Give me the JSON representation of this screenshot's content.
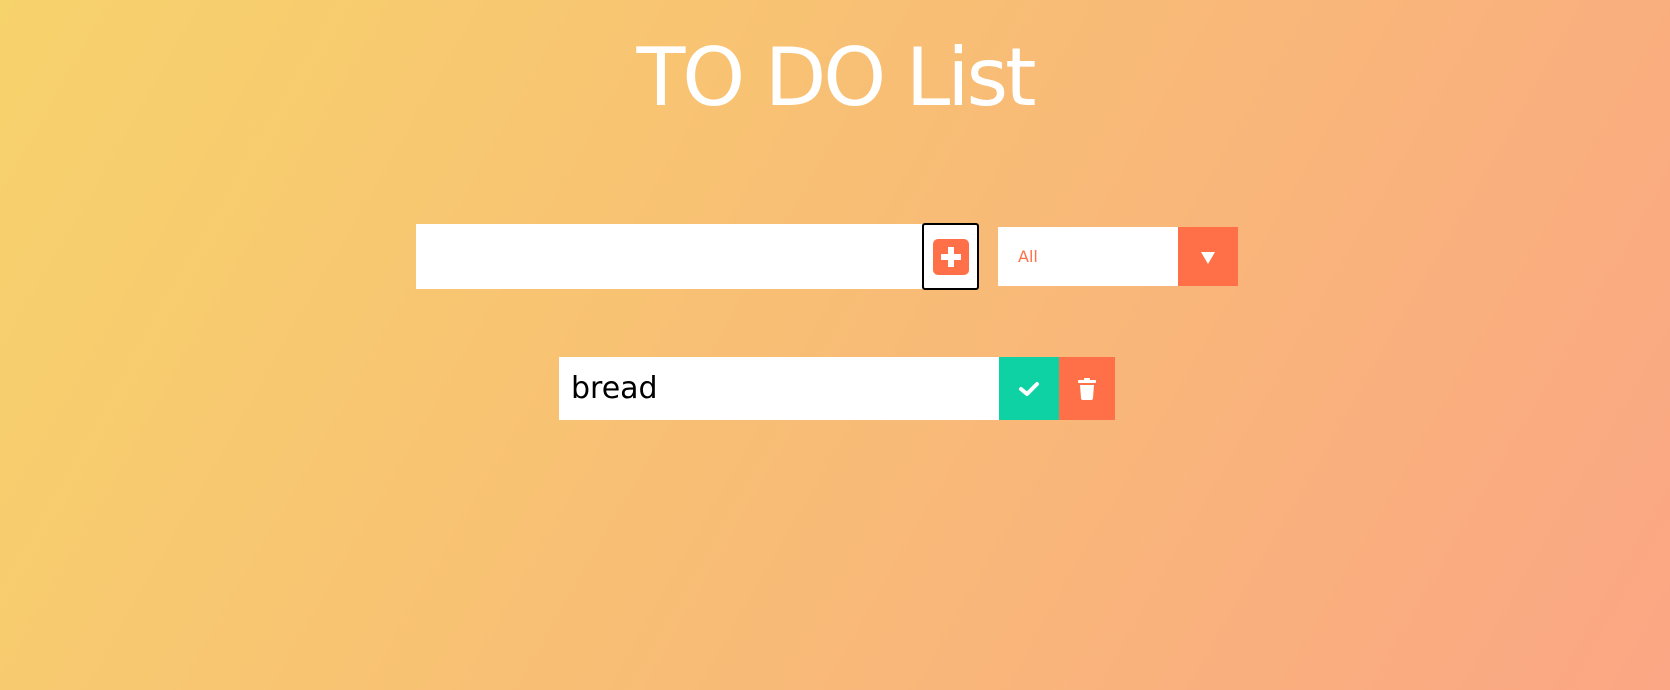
{
  "header": {
    "title": "TO DO List"
  },
  "form": {
    "input_value": "",
    "input_placeholder": "",
    "add_icon": "plus-square-icon",
    "filter": {
      "selected": "All",
      "arrow_icon": "triangle-down-icon"
    }
  },
  "todos": [
    {
      "text": "bread",
      "complete_icon": "check-icon",
      "delete_icon": "trash-icon"
    }
  ],
  "colors": {
    "accent": "#ff7048",
    "complete": "#0fd2a4",
    "gradient_start": "#f7d36c",
    "gradient_end": "#fba684",
    "text_light": "#ffffff"
  }
}
